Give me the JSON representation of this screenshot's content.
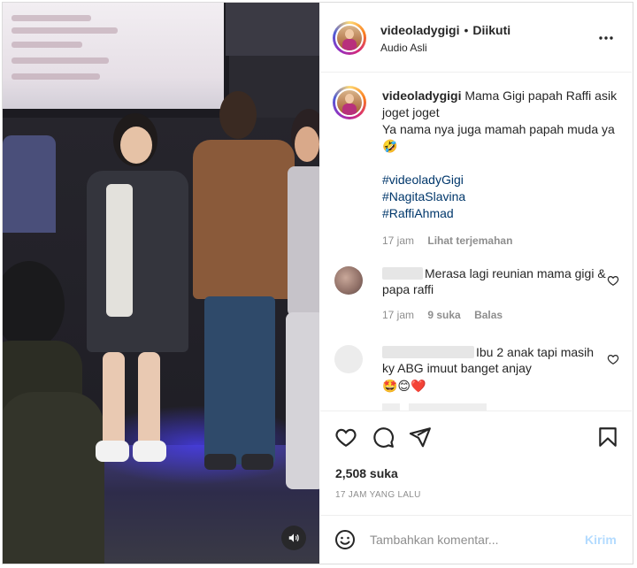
{
  "colors": {
    "text": "#262626",
    "muted": "#8e8e8e",
    "hashtag": "#00376b",
    "post_disabled": "#b3dbff",
    "border": "#dbdbdb",
    "heart_red": "#ed4956"
  },
  "header": {
    "username": "videoladygigi",
    "separator": "•",
    "follow_status": "Diikuti",
    "audio": "Audio Asli",
    "more_icon": "more-horizontal-icon"
  },
  "caption": {
    "username": "videoladygigi",
    "line1": "Mama Gigi papah Raffi asik joget joget",
    "line2": "Ya nama nya juga mamah papah muda ya🤣",
    "hashtags": [
      "#videoladyGigi",
      "#NagitaSlavina",
      "#RaffiAhmad"
    ],
    "time": "17 jam",
    "translate": "Lihat terjemahan"
  },
  "comments": [
    {
      "text": "Merasa lagi reunian mama gigi & papa raffi",
      "time": "17 jam",
      "likes": "9 suka",
      "reply": "Balas"
    },
    {
      "text": "Ibu 2 anak tapi masih ky ABG imuut banget anjay",
      "emojis": "🤩😊❤️"
    }
  ],
  "actions": {
    "like_icon": "heart-outline-icon",
    "comment_icon": "comment-icon",
    "share_icon": "send-icon",
    "save_icon": "bookmark-icon",
    "likes": "2,508 suka",
    "timestamp": "17 JAM YANG LALU"
  },
  "comment_box": {
    "placeholder": "Tambahkan komentar...",
    "post_label": "Kirim",
    "emoji_icon": "emoji-smile-icon"
  },
  "video": {
    "mute_icon": "speaker-icon"
  }
}
